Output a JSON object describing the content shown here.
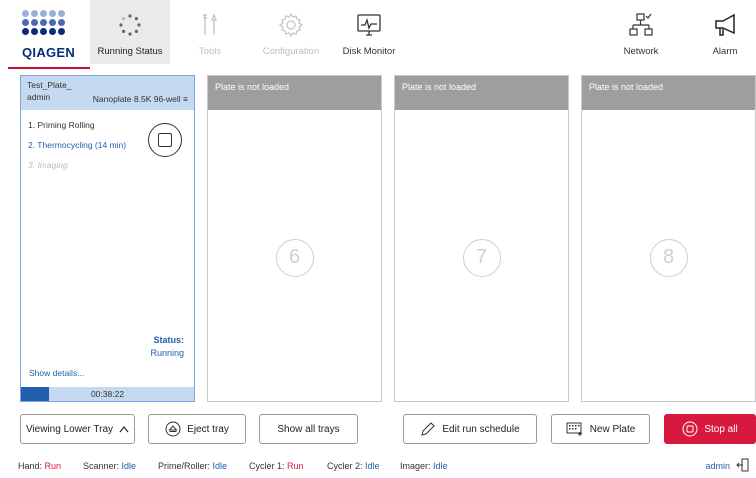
{
  "brand": {
    "name": "QIAGEN",
    "colors": {
      "navy": "#0a2a7a",
      "blue": "#1f5fae",
      "light_blue": "#c5d9f1",
      "red": "#d7193f"
    }
  },
  "nav": {
    "items": [
      {
        "label": "Running Status",
        "icon": "running-status-icon",
        "active": true
      },
      {
        "label": "Tools",
        "icon": "tools-icon",
        "disabled": true
      },
      {
        "label": "Configuration",
        "icon": "configuration-gear-icon",
        "disabled": true
      },
      {
        "label": "Disk Monitor",
        "icon": "disk-monitor-icon"
      },
      {
        "label": "Network",
        "icon": "network-icon"
      },
      {
        "label": "Alarm",
        "icon": "alarm-megaphone-icon"
      }
    ]
  },
  "active_plate": {
    "name": "Test_Plate_",
    "user": "admin",
    "type": "Nanoplate 8.5K 96-well",
    "menu_icon": "hamburger-icon",
    "steps": [
      {
        "label": "1. Priming Rolling",
        "state": "done"
      },
      {
        "label": "2. Thermocycling (14 min)",
        "state": "active"
      },
      {
        "label": "3. Imaging",
        "state": "pending"
      }
    ],
    "stop_icon": "stop-icon",
    "status_label": "Status:",
    "status_value": "Running",
    "details_link": "Show details...",
    "elapsed": "00:38:22",
    "progress": 0.16
  },
  "empty_slots": [
    {
      "header": "Plate is not loaded",
      "number": "6"
    },
    {
      "header": "Plate is not loaded",
      "number": "7"
    },
    {
      "header": "Plate is not loaded",
      "number": "8"
    }
  ],
  "buttons": {
    "viewing_tray": "Viewing Lower Tray",
    "eject_tray": "Eject tray",
    "show_all_trays": "Show all trays",
    "edit_run_schedule": "Edit run schedule",
    "new_plate": "New Plate",
    "stop_all": "Stop all"
  },
  "statusbar": {
    "items": [
      {
        "key": "Hand:",
        "value": "Run",
        "state": "run"
      },
      {
        "key": "Scanner:",
        "value": "Idle",
        "state": "idle"
      },
      {
        "key": "Prime/Roller:",
        "value": "Idle",
        "state": "idle"
      },
      {
        "key": "Cycler 1:",
        "value": "Run",
        "state": "run"
      },
      {
        "key": "Cycler 2:",
        "value": "Idle",
        "state": "idle"
      },
      {
        "key": "Imager:",
        "value": "Idle",
        "state": "idle"
      }
    ],
    "user": "admin",
    "logout_icon": "logout-icon"
  }
}
